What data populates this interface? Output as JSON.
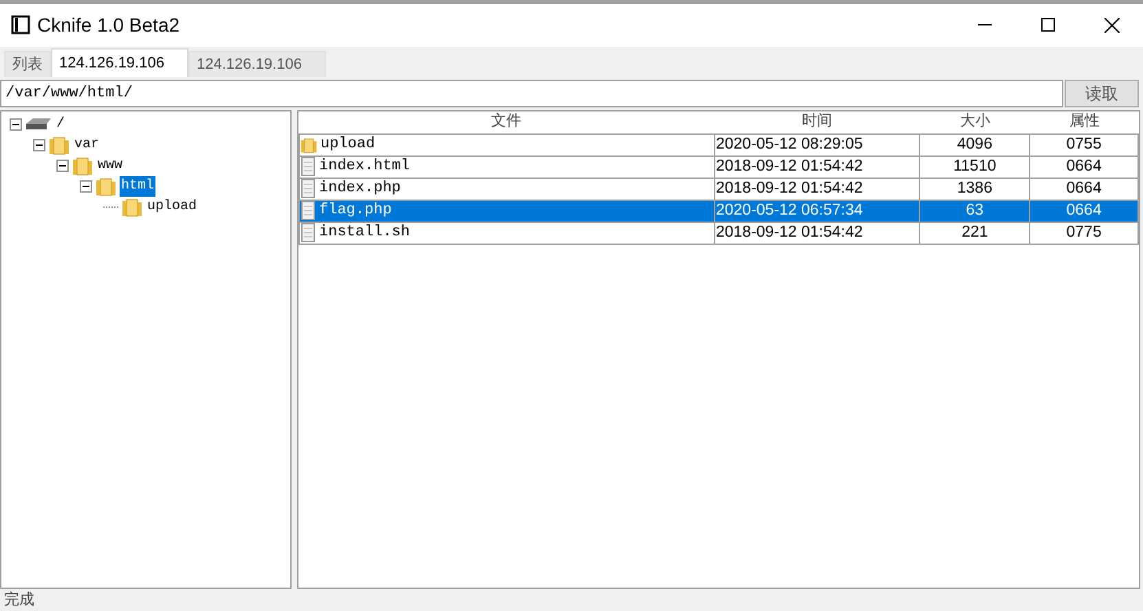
{
  "window": {
    "title": "Cknife 1.0 Beta2"
  },
  "tabs": [
    {
      "label": "列表",
      "selected": false
    },
    {
      "label": "124.126.19.106",
      "selected": true
    },
    {
      "label": "124.126.19.106",
      "selected": false
    }
  ],
  "path_field": {
    "value": "/var/www/html/"
  },
  "read_button": "读取",
  "tree": [
    {
      "label": "/",
      "kind": "drive",
      "expanded": true,
      "selected": false,
      "children": [
        {
          "label": "var",
          "kind": "folder",
          "expanded": true,
          "selected": false,
          "children": [
            {
              "label": "www",
              "kind": "folder",
              "expanded": true,
              "selected": false,
              "children": [
                {
                  "label": "html",
                  "kind": "folder",
                  "expanded": true,
                  "selected": true,
                  "children": [
                    {
                      "label": "upload",
                      "kind": "folder",
                      "selected": false
                    }
                  ]
                }
              ]
            }
          ]
        }
      ]
    }
  ],
  "table": {
    "columns": [
      "文件",
      "时间",
      "大小",
      "属性"
    ],
    "rows": [
      {
        "kind": "folder",
        "name": "upload",
        "time": "2020-05-12 08:29:05",
        "size": "4096",
        "mode": "0755",
        "selected": false
      },
      {
        "kind": "file",
        "name": "index.html",
        "time": "2018-09-12 01:54:42",
        "size": "11510",
        "mode": "0664",
        "selected": false
      },
      {
        "kind": "file",
        "name": "index.php",
        "time": "2018-09-12 01:54:42",
        "size": "1386",
        "mode": "0664",
        "selected": false
      },
      {
        "kind": "file",
        "name": "flag.php",
        "time": "2020-05-12 06:57:34",
        "size": "63",
        "mode": "0664",
        "selected": true
      },
      {
        "kind": "file",
        "name": "install.sh",
        "time": "2018-09-12 01:54:42",
        "size": "221",
        "mode": "0775",
        "selected": false
      }
    ]
  },
  "status_bar": "完成"
}
